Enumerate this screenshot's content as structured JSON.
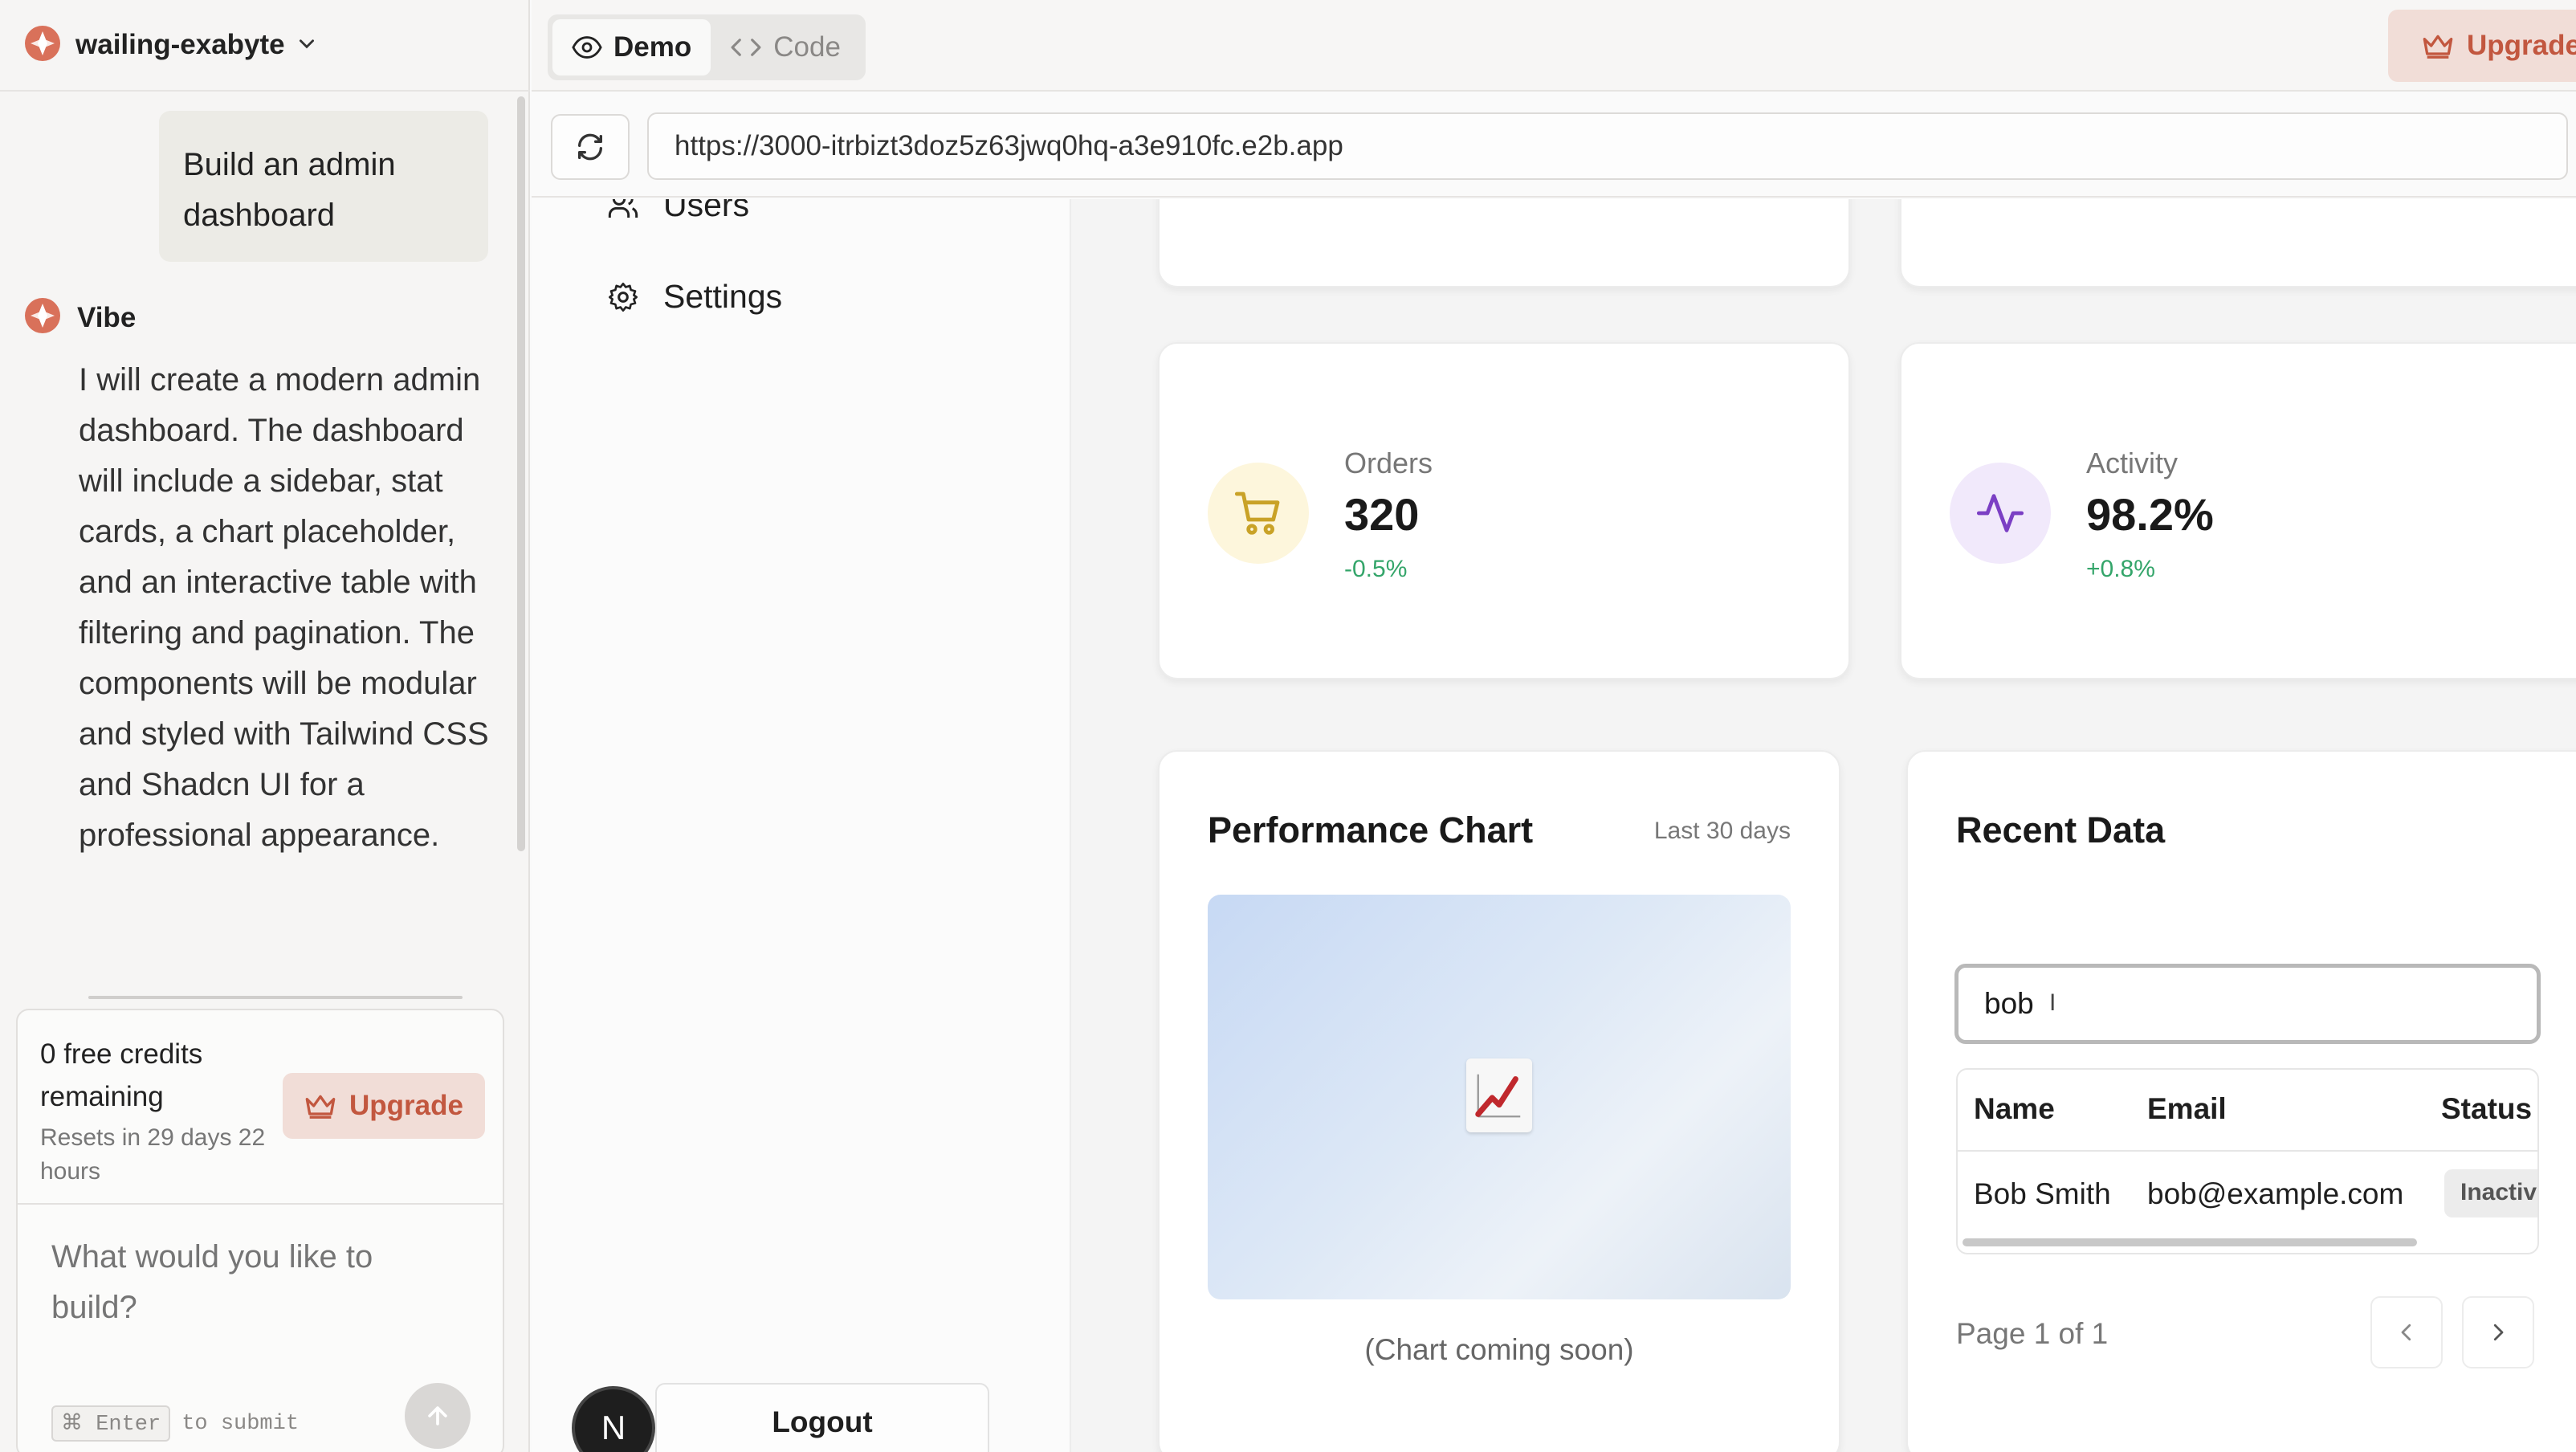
{
  "project": {
    "name": "wailing-exabyte"
  },
  "chat": {
    "user_message": "Build an admin dashboard",
    "assistant_name": "Vibe",
    "assistant_message": "I will create a modern admin dashboard. The dashboard will include a sidebar, stat cards, a chart placeholder, and an interactive table with filtering and pagination. The components will be modular and styled with Tailwind CSS and Shadcn UI for a professional appearance."
  },
  "composer": {
    "credits_title": "0 free credits remaining",
    "credits_reset": "Resets in 29 days 22 hours",
    "upgrade_label": "Upgrade",
    "placeholder": "What would you like to build?",
    "hint_key": "Enter",
    "hint_text": "to submit"
  },
  "topbar": {
    "tabs": [
      {
        "label": "Demo",
        "active": true
      },
      {
        "label": "Code",
        "active": false
      }
    ],
    "upgrade_label": "Upgrade"
  },
  "urlbar": {
    "url": "https://3000-itrbizt3doz5z63jwq0hq-a3e910fc.e2b.app"
  },
  "app": {
    "nav": [
      {
        "label": "Users",
        "icon": "users-icon"
      },
      {
        "label": "Settings",
        "icon": "gear-icon"
      }
    ],
    "avatar_initial": "N",
    "logout_label": "Logout",
    "stats": [
      {
        "label": "Orders",
        "value": "320",
        "change": "-0.5%",
        "icon": "shopping-cart-icon",
        "color": "#c9a227",
        "bg": "#fdf6dc"
      },
      {
        "label": "Activity",
        "value": "98.2%",
        "change": "+0.8%",
        "icon": "activity-icon",
        "color": "#7b3fc4",
        "bg": "#f1e9fb"
      }
    ],
    "chart": {
      "title": "Performance Chart",
      "range": "Last 30 days",
      "placeholder_note": "(Chart coming soon)"
    },
    "table": {
      "title": "Recent Data",
      "filter_value": "bob",
      "columns": [
        "Name",
        "Email",
        "Status"
      ],
      "rows": [
        {
          "name": "Bob Smith",
          "email": "bob@example.com",
          "status": "Inactive"
        }
      ],
      "page_info": "Page 1 of 1"
    }
  },
  "colors": {
    "accent": "#c2573f",
    "upgrade_bg": "#f1ddd7",
    "positive": "#34a56a"
  }
}
